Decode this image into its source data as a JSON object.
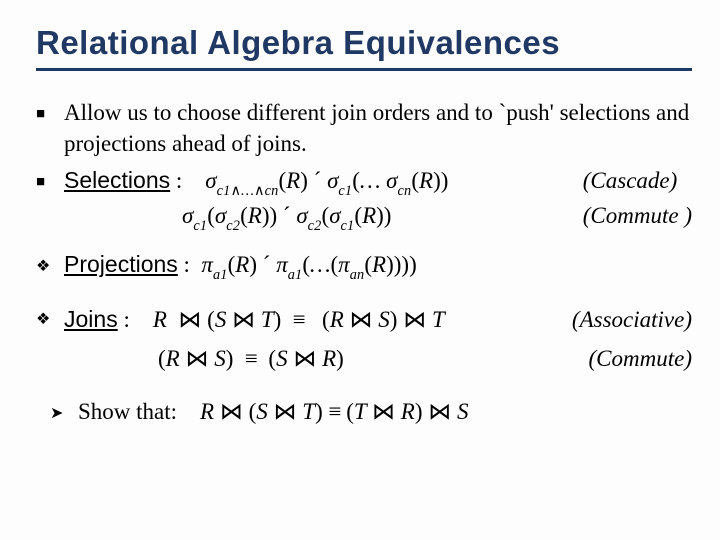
{
  "title": "Relational Algebra Equivalences",
  "intro": "Allow us to choose different join orders and to `push' selections and projections ahead of joins.",
  "selections": {
    "label": "Selections",
    "colon": " :",
    "cascade_formula_html": "σ<sub>c1∧…∧cn</sub>(R) ´ σ<sub>c1</sub>(… σ<sub>cn</sub>(R))",
    "cascade_note": "(Cascade)",
    "commute_formula_html": "σ<sub>c1</sub>(σ<sub>c2</sub>(R)) ´ σ<sub>c2</sub>(σ<sub>c1</sub>(R))",
    "commute_note": "(Commute )"
  },
  "projections": {
    "label": "Projections",
    "colon": " :",
    "formula_html": "π<sub>a1</sub>(R) ´ π<sub>a1</sub>(…(π<sub>an</sub>(R))))"
  },
  "joins": {
    "label": "Joins",
    "colon": " :",
    "assoc_formula_html": "R ⋈ (S ⋈ T) ≡ (R ⋈ S) ⋈ T",
    "assoc_note": "(Associative)",
    "commute_formula_html": "(R ⋈ S) ≡ (S ⋈ R)",
    "commute_note": "(Commute)"
  },
  "show_that": {
    "label": "Show that:",
    "formula_html": "R ⋈ (S ⋈ T) ≡ (T ⋈ R) ⋈ S"
  }
}
